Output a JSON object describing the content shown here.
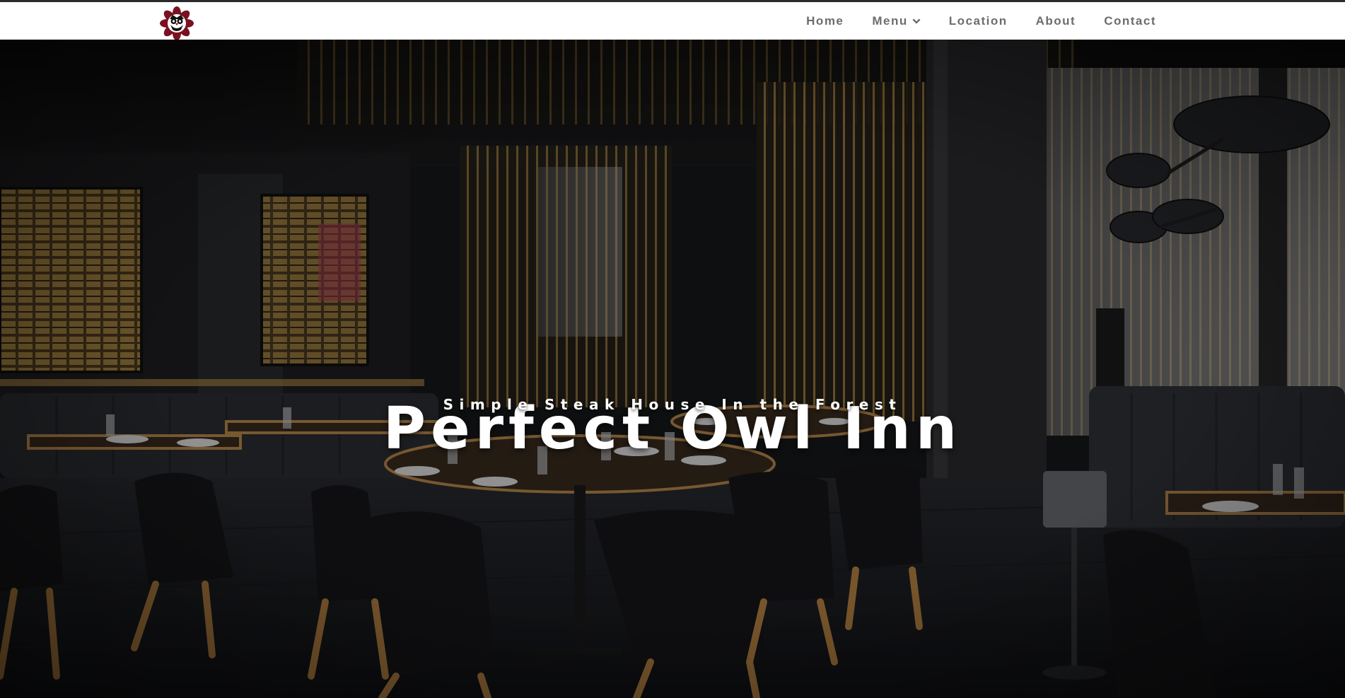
{
  "nav": {
    "logo_name": "owl-logo-icon",
    "items": [
      {
        "label": "Home",
        "has_dropdown": false
      },
      {
        "label": "Menu",
        "has_dropdown": true
      },
      {
        "label": "Location",
        "has_dropdown": false
      },
      {
        "label": "About",
        "has_dropdown": false
      },
      {
        "label": "Contact",
        "has_dropdown": false
      }
    ]
  },
  "hero": {
    "title": "Perfect Owl Inn",
    "subtitle": "Simple Steak House In the Forest"
  },
  "colors": {
    "nav_text": "#6d6d6d",
    "logo_primary": "#7a1020",
    "hero_overlay": "#000000",
    "hero_text": "#ffffff"
  }
}
